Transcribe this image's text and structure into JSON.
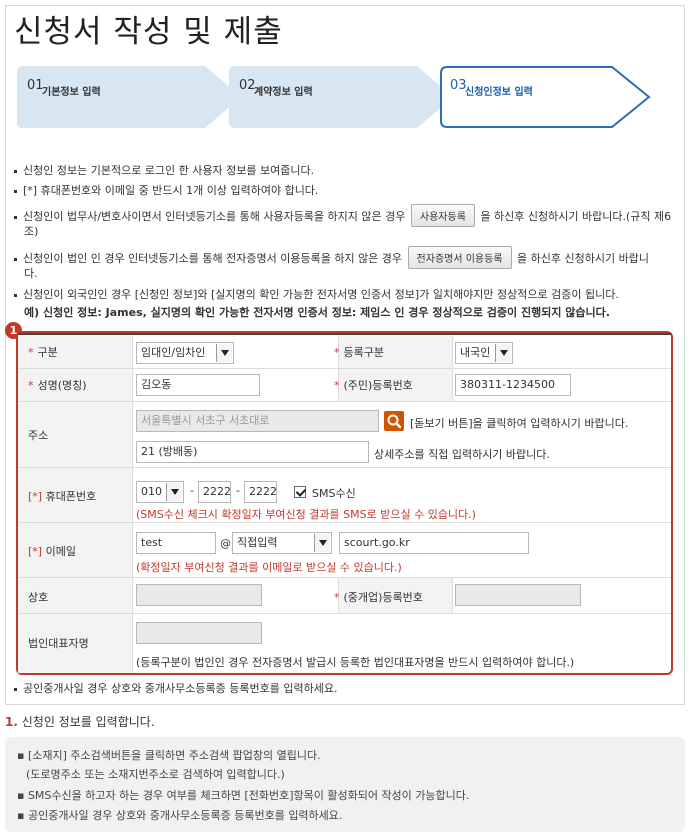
{
  "title": "신청서 작성 및 제출",
  "steps": [
    {
      "num": "01",
      "label": "기본정보 입력",
      "active": false
    },
    {
      "num": "02",
      "label": "계약정보 입력",
      "active": false
    },
    {
      "num": "03",
      "label": "신청인정보 입력",
      "active": true
    }
  ],
  "notices": {
    "n1": "신청인 정보는 기본적으로 로그인 한 사용자 정보를 보여줍니다.",
    "n2": "[*] 휴대폰번호와 이메일 중 반드시 1개 이상 입력하여야 합니다.",
    "n3_pre": "신청인이 법무사/변호사이면서 인터넷등기소를 통해 사용자등록을 하지지 않은 경우",
    "n3_btn": "사용자등록",
    "n3_post": "을 하신후 신청하시기 바랍니다.(규칙 제6",
    "n3_wrap": "조)",
    "n4_pre": "신청인이 법인 인 경우 인터넷등기소를 통해 전자증명서 이용등록을 하지 않은 경우",
    "n4_btn": "전자증명서 이용등록",
    "n4_post": "을 하신후 신청하시기 바랍니",
    "n4_wrap": "다.",
    "n5": "신청인이 외국인인 경우 [신청인 정보]와 [실지명의 확인 가능한 전자서명 인증서 정보]가 일치해야지만 정상적으로 검증이 됩니다.",
    "n6": "예) 신청인 정보: James, 실지명의 확인 가능한 전자서명 인증서 정보: 제임스 인 경우 정상적으로 검증이 진행되지 않습니다."
  },
  "form": {
    "badge": "1",
    "gubun_label": "구분",
    "gubun_value": "임대인/임차인",
    "reg_type_label": "등록구분",
    "reg_type_value": "내국인",
    "name_label": "성명(명칭)",
    "name_value": "김오동",
    "id_label": "(주민)등록번호",
    "id_value": "380311-1234500",
    "addr_label": "주소",
    "addr_placeholder": "서울특별시 서초구 서초대로",
    "addr_hint": "[돋보기 버튼]을 클릭하여 입력하시기 바랍니다.",
    "addr_detail": "21 (방배동)",
    "addr_detail_hint": "상세주소를 직접 입력하시기 바랍니다.",
    "phone_label": "휴대폰번호",
    "phone_star": "[*]",
    "phone1": "010",
    "phone_dash": "-",
    "phone2": "2222",
    "phone3": "2222",
    "sms_label": "SMS수신",
    "sms_note": "(SMS수신 체크시 확정일자 부여신청 결과를 SMS로 받으실 수 있습니다.)",
    "email_label": "이메일",
    "email_star": "[*]",
    "email_id": "test",
    "email_at": "@",
    "email_select": "직접입력",
    "email_domain": "scourt.go.kr",
    "email_note": "(확정일자 부여신청 결과를 이메일로 받으실 수 있습니다.)",
    "company_label": "상호",
    "broker_label": "(중개업)등록번호",
    "rep_label": "법인대표자명",
    "rep_note": "(등록구분이 법인인 경우 전자증명서 발급시 등록한 법인대표자명을 반드시 입력하여야 합니다.)",
    "after_note": "공인중개사일 경우 상호와 중개사무소등록증 등록번호를 입력하세요."
  },
  "guide": {
    "num": "1.",
    "title": "신청인 정보를 입력합니다.",
    "lines": [
      "[소재지] 주소검색버튼을 클릭하면 주소검색 팝업창의 열립니다.",
      "(도로명주소 또는 소재지번주소로 검색하여 입력합니다.)",
      "SMS수신을 하고자 하는 경우 여부를 체크하면 [전화번호]항목이 활성화되어 작성이 가능합니다.",
      "공인중개사일 경우 상호와 중개사무소등록증 등록번호를 입력하세요."
    ]
  }
}
